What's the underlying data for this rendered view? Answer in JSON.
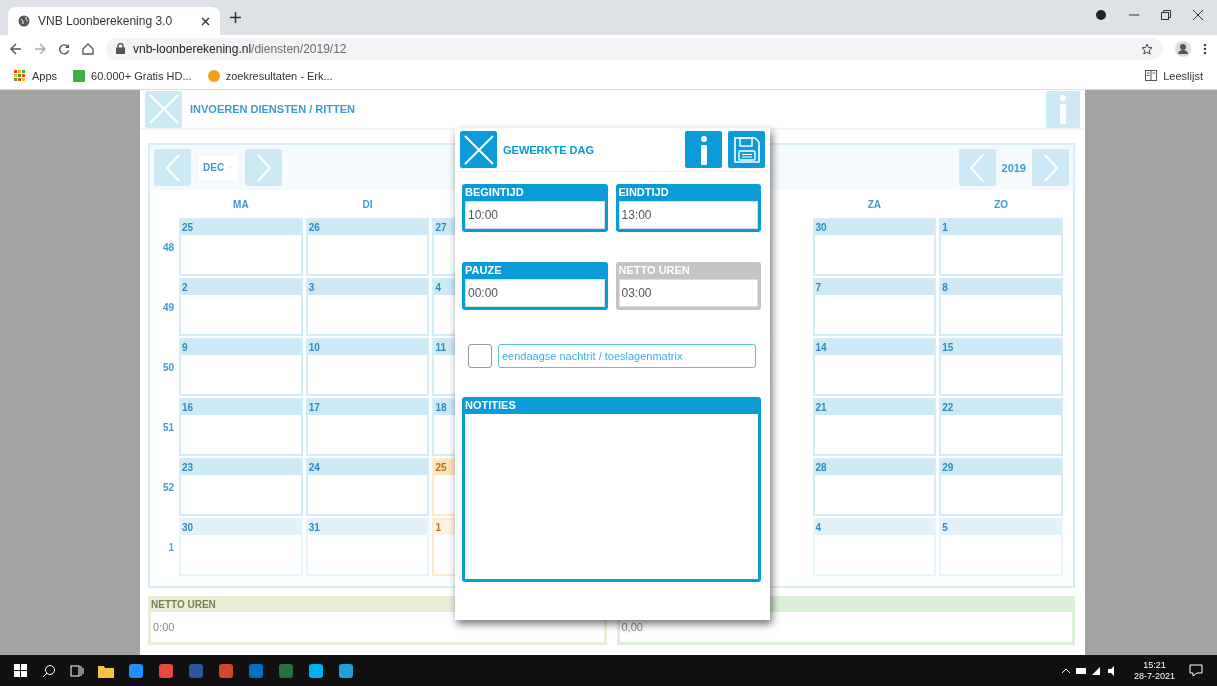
{
  "browser": {
    "tab_title": "VNB Loonberekening 3.0",
    "url_host": "vnb-loonberekening.nl",
    "url_path": "/diensten/2019/12",
    "bookmarks": [
      "Apps",
      "60.000+ Gratis HD...",
      "zoekresultaten - Erk..."
    ],
    "reading_list": "Leeslijst"
  },
  "page": {
    "title": "INVOEREN DIENSTEN / RITTEN",
    "month": "DEC",
    "year": "2019",
    "weekdays_left": [
      "MA",
      "DI"
    ],
    "weekdays_right": [
      "ZA",
      "ZO"
    ],
    "weeks": [
      {
        "number": "48",
        "faded": false,
        "days_left": [
          {
            "day": "25",
            "holiday": false
          },
          {
            "day": "26",
            "holiday": false
          },
          {
            "day": "27",
            "holiday": false
          }
        ],
        "days_right": [
          {
            "day": "30",
            "holiday": false
          },
          {
            "day": "1",
            "holiday": false
          }
        ]
      },
      {
        "number": "49",
        "faded": false,
        "days_left": [
          {
            "day": "2",
            "holiday": false
          },
          {
            "day": "3",
            "holiday": false
          },
          {
            "day": "4",
            "holiday": false
          }
        ],
        "days_right": [
          {
            "day": "7",
            "holiday": false
          },
          {
            "day": "8",
            "holiday": false
          }
        ]
      },
      {
        "number": "50",
        "faded": false,
        "days_left": [
          {
            "day": "9",
            "holiday": false
          },
          {
            "day": "10",
            "holiday": false
          },
          {
            "day": "11",
            "holiday": false
          }
        ],
        "days_right": [
          {
            "day": "14",
            "holiday": false
          },
          {
            "day": "15",
            "holiday": false
          }
        ]
      },
      {
        "number": "51",
        "faded": false,
        "days_left": [
          {
            "day": "16",
            "holiday": false
          },
          {
            "day": "17",
            "holiday": false
          },
          {
            "day": "18",
            "holiday": false
          }
        ],
        "days_right": [
          {
            "day": "21",
            "holiday": false
          },
          {
            "day": "22",
            "holiday": false
          }
        ]
      },
      {
        "number": "52",
        "faded": false,
        "days_left": [
          {
            "day": "23",
            "holiday": false
          },
          {
            "day": "24",
            "holiday": false
          },
          {
            "day": "25",
            "holiday": true
          }
        ],
        "days_right": [
          {
            "day": "28",
            "holiday": false
          },
          {
            "day": "29",
            "holiday": false
          }
        ]
      },
      {
        "number": "1",
        "faded": true,
        "days_left": [
          {
            "day": "30",
            "holiday": false
          },
          {
            "day": "31",
            "holiday": false
          },
          {
            "day": "1",
            "holiday": true
          }
        ],
        "days_right": [
          {
            "day": "4",
            "holiday": false
          },
          {
            "day": "5",
            "holiday": false
          }
        ]
      }
    ],
    "totals": [
      {
        "label": "NETTO UREN",
        "value": "0:00",
        "color": "#ebedda"
      },
      {
        "value": "0,00",
        "color": "#dcefd8"
      }
    ]
  },
  "dialog": {
    "title": "GEWERKTE DAG",
    "fields": [
      {
        "label": "BEGINTIJD",
        "value": "10:00",
        "disabled": false
      },
      {
        "label": "EINDTIJD",
        "value": "13:00",
        "disabled": false
      },
      {
        "label": "PAUZE",
        "value": "00:00",
        "disabled": false
      },
      {
        "label": "NETTO UREN",
        "value": "03:00",
        "disabled": true
      }
    ],
    "option": {
      "checked": false,
      "value": "eendaagse nachtrit / toeslagenmatrix"
    },
    "notes_label": "NOTITIES"
  },
  "taskbar": {
    "time": "15:21",
    "date": "28-7-2021"
  }
}
